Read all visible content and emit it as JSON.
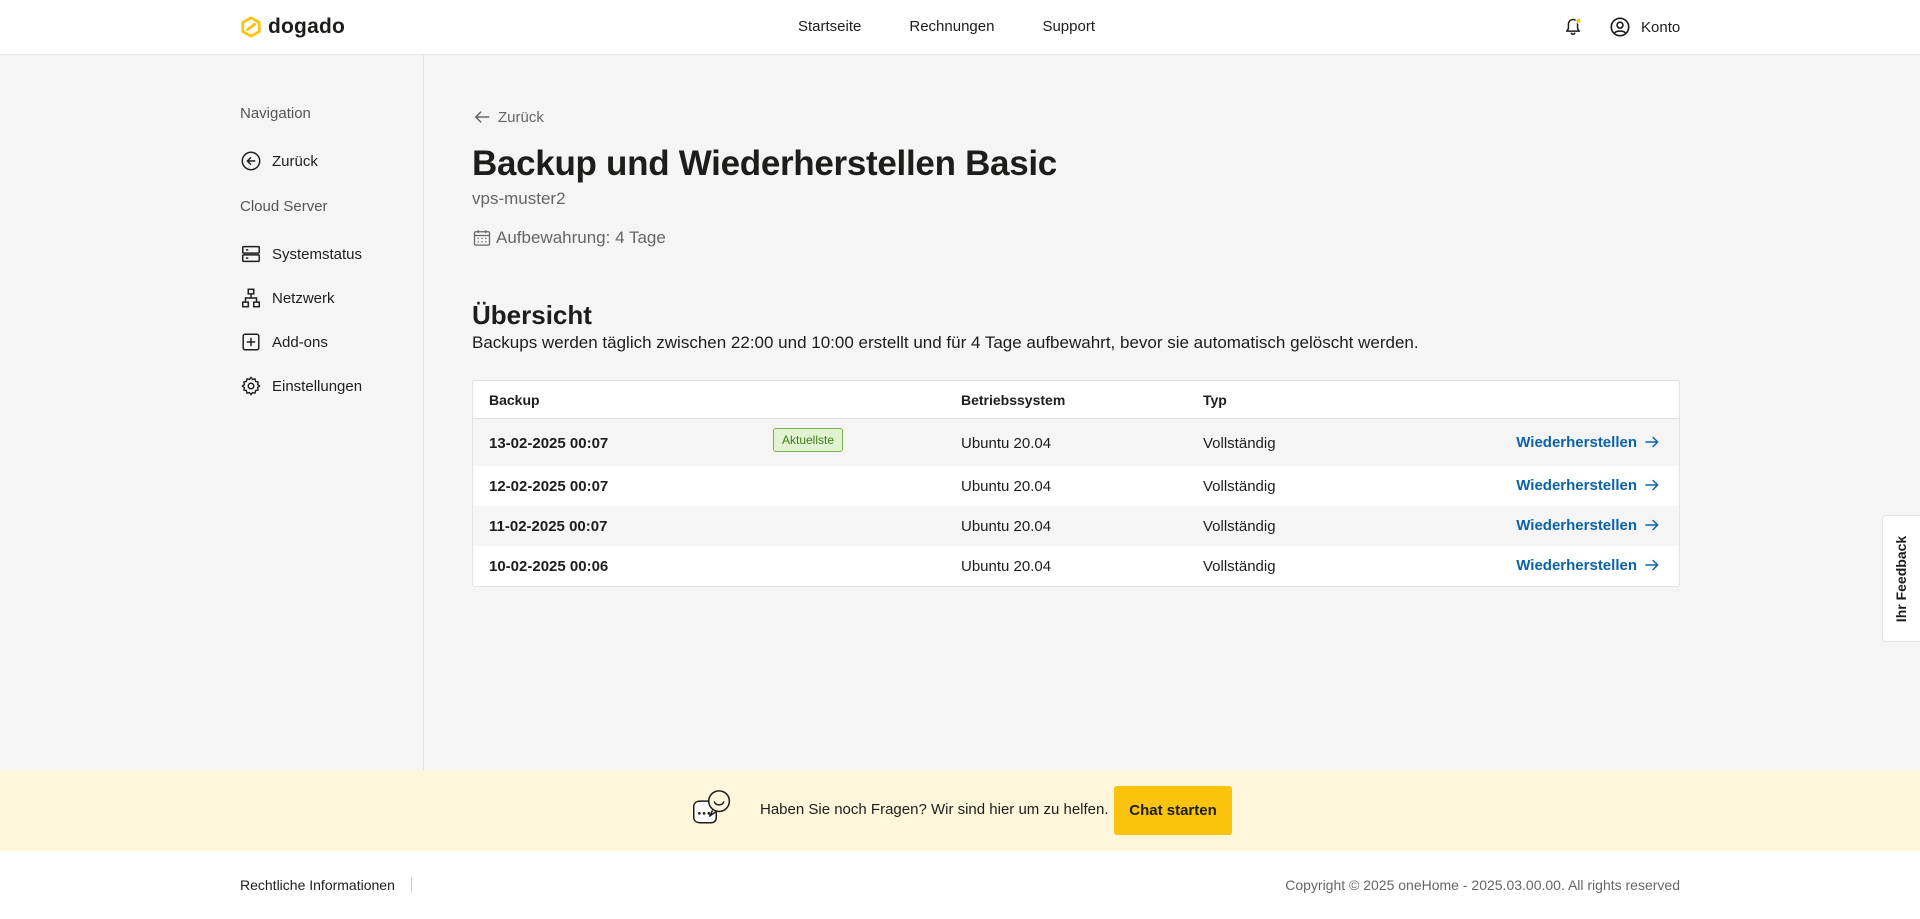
{
  "brand": {
    "name": "dogado",
    "accent": "#fbc30c"
  },
  "header": {
    "nav": [
      "Startseite",
      "Rechnungen",
      "Support"
    ],
    "account_label": "Konto",
    "notification_dot_color": "#fbc30c"
  },
  "sidebar": {
    "section_navigation": "Navigation",
    "back_label": "Zurück",
    "section_cloud": "Cloud Server",
    "items": [
      {
        "label": "Systemstatus",
        "icon": "server-icon"
      },
      {
        "label": "Netzwerk",
        "icon": "network-icon"
      },
      {
        "label": "Add-ons",
        "icon": "plus-square-icon"
      },
      {
        "label": "Einstellungen",
        "icon": "gear-icon"
      }
    ]
  },
  "main": {
    "back_label": "Zurück",
    "title": "Backup und Wiederherstellen Basic",
    "server_name": "vps-muster2",
    "retention": "Aufbewahrung: 4 Tage",
    "overview_title": "Übersicht",
    "overview_desc": "Backups werden täglich zwischen 22:00 und 10:00 erstellt und für 4 Tage aufbewahrt, bevor sie automatisch gelöscht werden."
  },
  "table": {
    "headers": {
      "backup": "Backup",
      "os": "Betriebssystem",
      "type": "Typ"
    },
    "latest_badge": "Aktuellste",
    "restore_label": "Wiederherstellen",
    "rows": [
      {
        "date": "13-02-2025 00:07",
        "os": "Ubuntu 20.04",
        "type": "Vollständig"
      },
      {
        "date": "12-02-2025 00:07",
        "os": "Ubuntu 20.04",
        "type": "Vollständig"
      },
      {
        "date": "11-02-2025 00:07",
        "os": "Ubuntu 20.04",
        "type": "Vollständig"
      },
      {
        "date": "10-02-2025 00:06",
        "os": "Ubuntu 20.04",
        "type": "Vollständig"
      }
    ]
  },
  "feedback_tab": "Ihr Feedback",
  "help": {
    "text": "Haben Sie noch Fragen? Wir sind hier um zu helfen.",
    "button": "Chat starten"
  },
  "footer": {
    "legal": "Rechtliche Informationen",
    "copyright": "Copyright © 2025 oneHome - 2025.03.00.00. All rights reserved"
  }
}
